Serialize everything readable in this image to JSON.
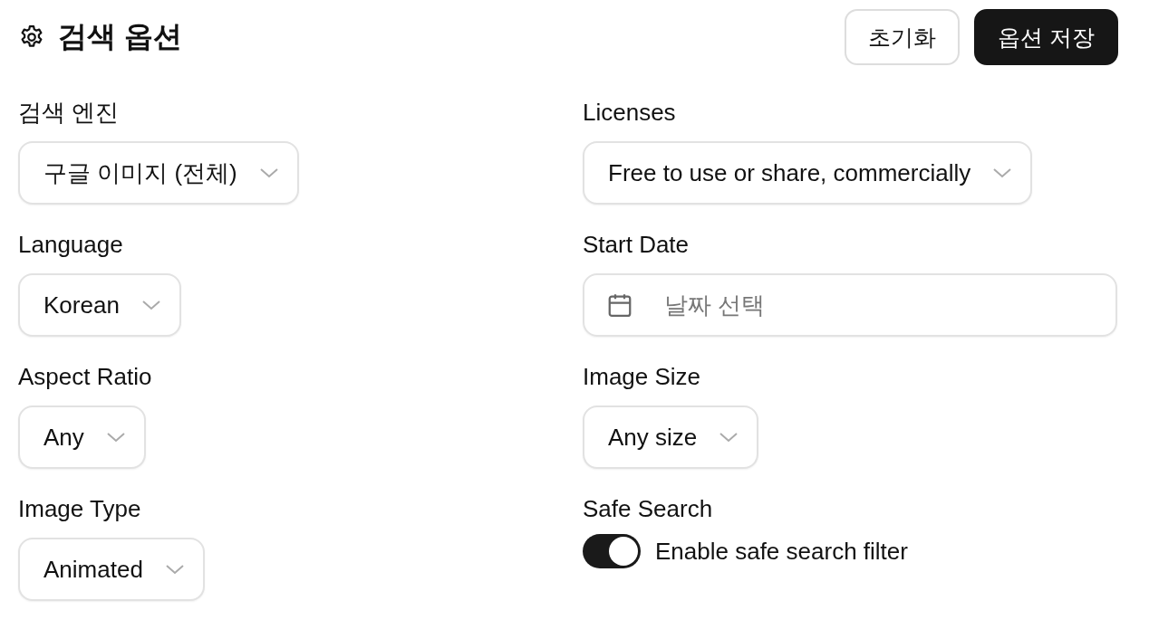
{
  "header": {
    "title": "검색 옵션",
    "buttons": [
      {
        "label": "초기화",
        "kind": "secondary"
      },
      {
        "label": "옵션 저장",
        "kind": "primary"
      }
    ]
  },
  "left_column": [
    {
      "kind": "select",
      "label": "검색 엔진",
      "value": "구글 이미지 (전체)"
    },
    {
      "kind": "select",
      "label": "Language",
      "value": "Korean"
    },
    {
      "kind": "select",
      "label": "Aspect Ratio",
      "value": "Any"
    },
    {
      "kind": "select",
      "label": "Image Type",
      "value": "Animated"
    }
  ],
  "right_column": [
    {
      "kind": "select",
      "label": "Licenses",
      "value": "Free to use or share, commercially"
    },
    {
      "kind": "date",
      "label": "Start Date",
      "placeholder": "날짜 선택"
    },
    {
      "kind": "select",
      "label": "Image Size",
      "value": "Any size"
    },
    {
      "kind": "toggle",
      "label": "Safe Search",
      "text": "Enable safe search filter",
      "on": true
    }
  ]
}
